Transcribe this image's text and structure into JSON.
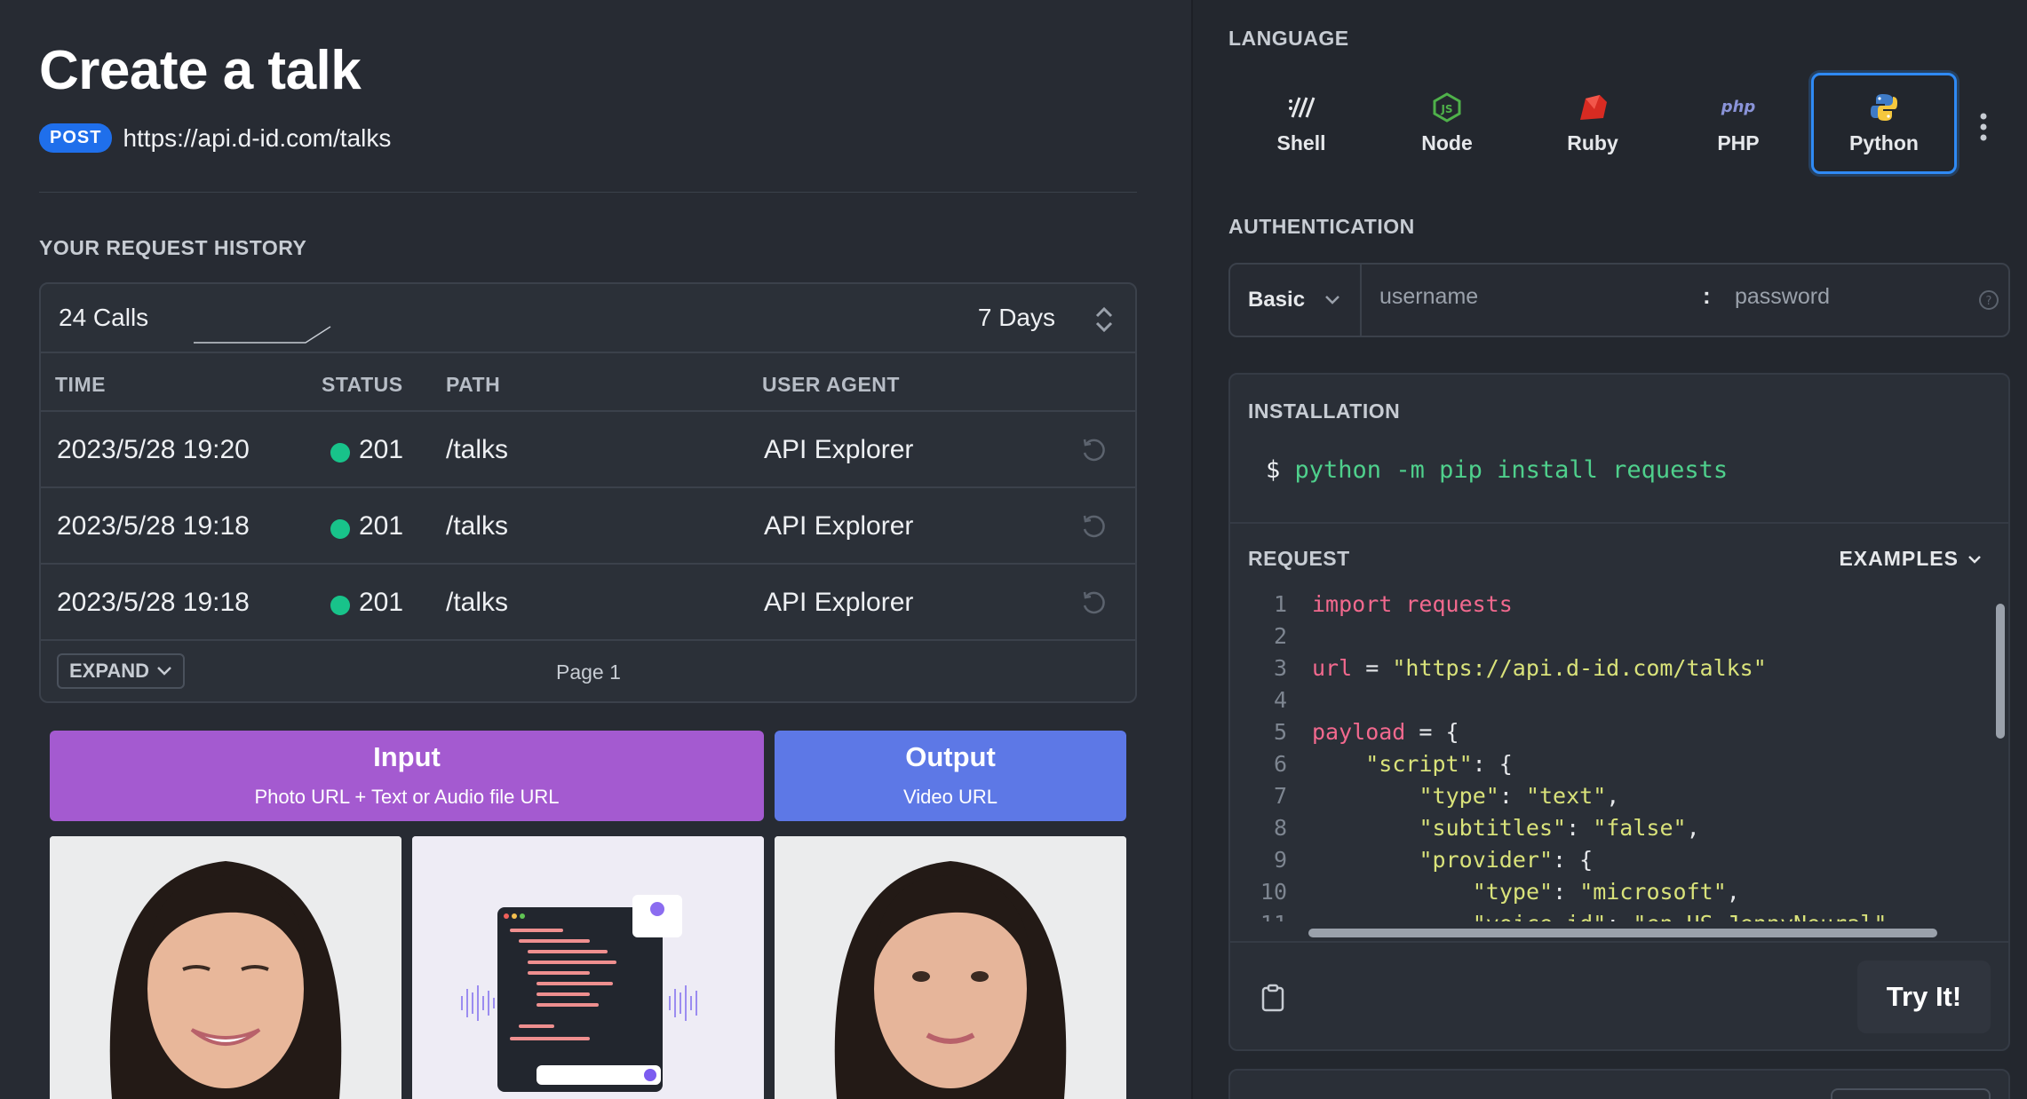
{
  "header": {
    "title": "Create a talk",
    "method": "POST",
    "url": "https://api.d-id.com/talks"
  },
  "history": {
    "label": "YOUR REQUEST HISTORY",
    "calls": "24 Calls",
    "range": "7 Days",
    "columns": [
      "TIME",
      "STATUS",
      "PATH",
      "USER AGENT"
    ],
    "rows": [
      {
        "time": "2023/5/28 19:20",
        "status": "201",
        "path": "/talks",
        "agent": "API Explorer"
      },
      {
        "time": "2023/5/28 19:18",
        "status": "201",
        "path": "/talks",
        "agent": "API Explorer"
      },
      {
        "time": "2023/5/28 19:18",
        "status": "201",
        "path": "/talks",
        "agent": "API Explorer"
      }
    ],
    "expand_label": "EXPAND",
    "page_label": "Page 1",
    "status_color": "#18c38a"
  },
  "diagram": {
    "input_title": "Input",
    "input_sub": "Photo URL + Text or Audio file URL",
    "output_title": "Output",
    "output_sub": "Video URL",
    "input_color": "#a45ad0",
    "output_color": "#5d78e6"
  },
  "language": {
    "label": "LANGUAGE",
    "options": [
      {
        "name": "Shell",
        "icon": "shell-icon"
      },
      {
        "name": "Node",
        "icon": "node-icon"
      },
      {
        "name": "Ruby",
        "icon": "ruby-icon"
      },
      {
        "name": "PHP",
        "icon": "php-icon"
      },
      {
        "name": "Python",
        "icon": "python-icon",
        "active": true
      }
    ],
    "php_logo_text": "php"
  },
  "auth": {
    "label": "AUTHENTICATION",
    "type": "Basic",
    "username_placeholder": "username",
    "separator": ":",
    "password_placeholder": "password"
  },
  "installation": {
    "label": "INSTALLATION",
    "prompt": "$",
    "command": "python -m pip install requests"
  },
  "request": {
    "label": "REQUEST",
    "examples_label": "EXAMPLES",
    "code_lines": [
      "import requests",
      "",
      "url = \"https://api.d-id.com/talks\"",
      "",
      "payload = {",
      "    \"script\": {",
      "        \"type\": \"text\",",
      "        \"subtitles\": \"false\",",
      "        \"provider\": {",
      "            \"type\": \"microsoft\",",
      "            \"voice_id\": \"en-US-JennyNeural\""
    ],
    "try_label": "Try It!"
  }
}
